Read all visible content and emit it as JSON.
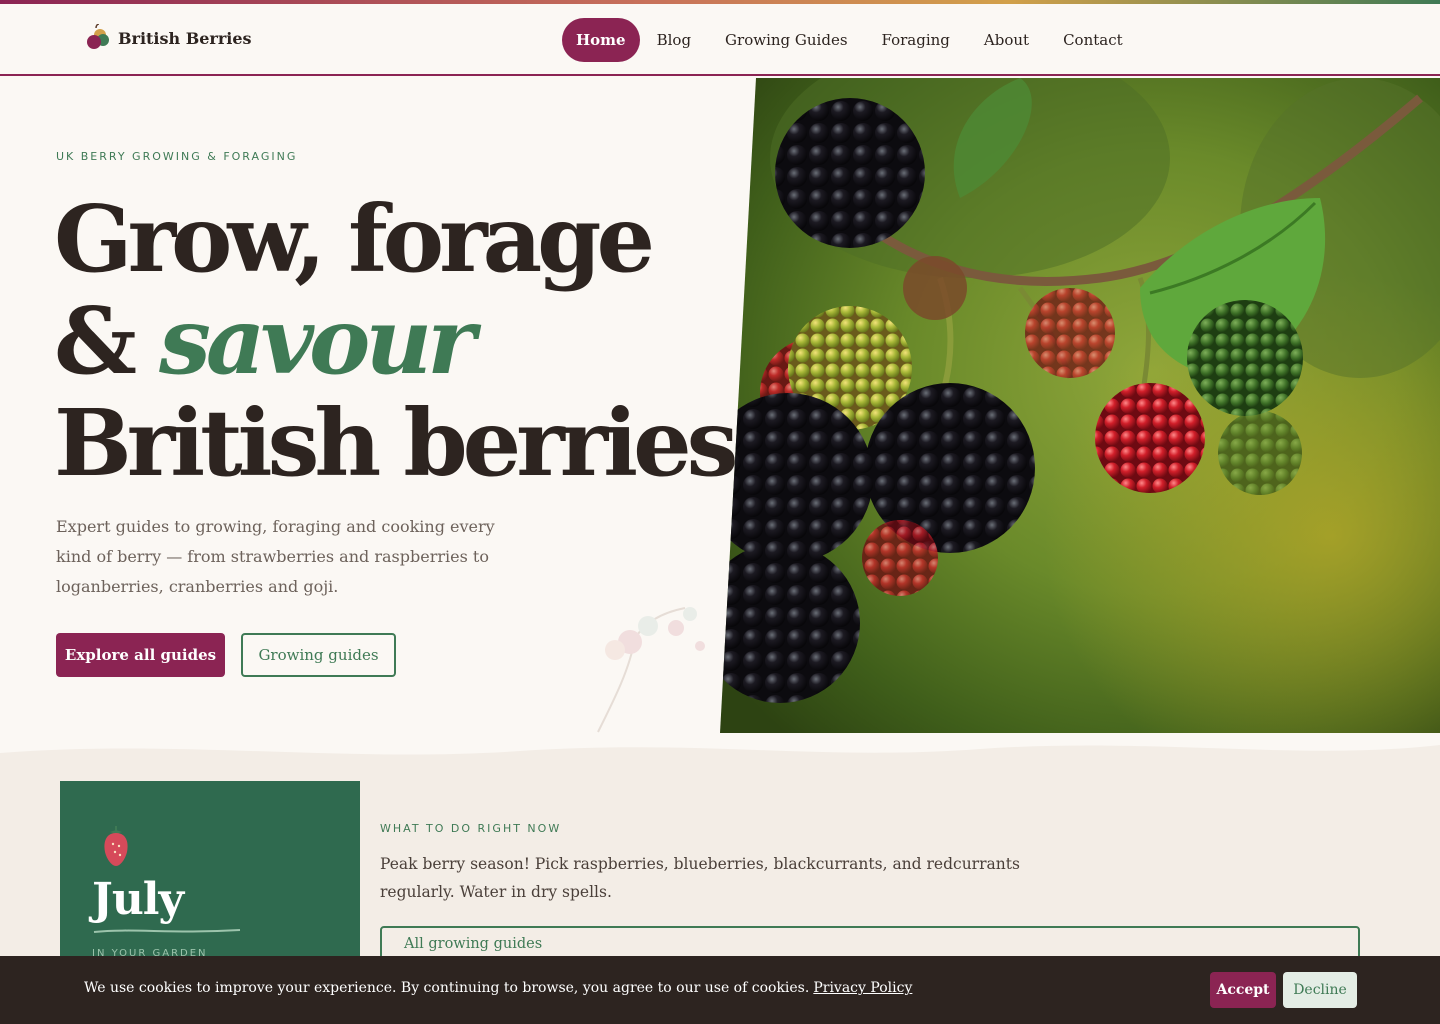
{
  "brand": {
    "name": "British Berries",
    "logo_icon": "berry-logo-icon"
  },
  "nav": {
    "items": [
      {
        "label": "Home",
        "active": true
      },
      {
        "label": "Blog"
      },
      {
        "label": "Growing Guides"
      },
      {
        "label": "Foraging"
      },
      {
        "label": "About"
      },
      {
        "label": "Contact"
      }
    ]
  },
  "hero": {
    "eyebrow": "UK BERRY GROWING & FORAGING",
    "headline_line1": "Grow, forage",
    "headline_amp": "&",
    "headline_accent": "savour",
    "headline_line3": "British berries",
    "lede": "Expert guides to growing, foraging and cooking every kind of berry — from strawberries and raspberries to loganberries, cranberries and goji.",
    "primary_cta": "Explore all guides",
    "secondary_cta": "Growing guides",
    "image": "blackberries-photo"
  },
  "seasonal": {
    "month": "July",
    "month_sub": "IN YOUR GARDEN",
    "eyebrow": "WHAT TO DO RIGHT NOW",
    "text": "Peak berry season! Pick raspberries, blueberries, blackcurrants, and redcurrants regularly. Water in dry spells.",
    "link": "All growing guides"
  },
  "cookie": {
    "text": "We use cookies to improve your experience. By continuing to browse, you agree to our use of cookies.",
    "policy_link": "Privacy Policy",
    "accept": "Accept",
    "decline": "Decline"
  },
  "colors": {
    "primary": "#8b2453",
    "accent_green": "#2f6a4f",
    "background": "#fbf8f4",
    "text": "#2d2420"
  }
}
